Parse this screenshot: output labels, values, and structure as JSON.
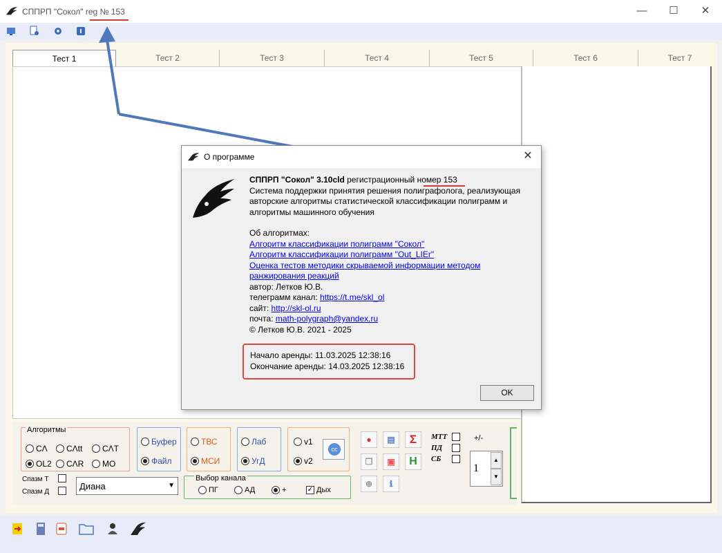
{
  "window": {
    "title_prefix": "СППРП \"Сокол\"",
    "title_reg": "reg № 153",
    "minimize": "—",
    "maximize": "☐",
    "close": "✕"
  },
  "toolbar": {
    "icons": [
      "monitor-icon",
      "document-search-icon",
      "gear-icon",
      "info-icon"
    ]
  },
  "tabs": [
    "Тест 1",
    "Тест 2",
    "Тест 3",
    "Тест 4",
    "Тест 5",
    "Тест 6",
    "Тест 7"
  ],
  "controls": {
    "algorithms": {
      "label": "Алгоритмы",
      "options": [
        "СΛ",
        "СΛtt",
        "СΛТ",
        "OL2",
        "СΛR",
        "МО"
      ],
      "selected": "OL2"
    },
    "source": {
      "options": [
        "Буфер",
        "Файл"
      ],
      "selected": "Файл"
    },
    "test_type": {
      "options": [
        "ТВС",
        "МСИ"
      ],
      "selected": "МСИ"
    },
    "lab": {
      "options": [
        "Лаб",
        "УгД"
      ],
      "selected": "УгД"
    },
    "version": {
      "options": [
        "v1",
        "v2"
      ],
      "selected": "v2"
    },
    "cc_button": "cc",
    "spasm_t": "Спазм Т",
    "spasm_d": "Спазм Д",
    "person": "Диана",
    "channel": {
      "label": "Выбор канала",
      "options": [
        "ПГ",
        "АД",
        "+"
      ],
      "selected": "+",
      "breath_label": "Дых",
      "breath_checked": true
    },
    "flags": [
      "МТТ",
      "ПД",
      "СБ"
    ],
    "plusminus_label": "+/-",
    "spinner_value": "1",
    "sigma": "Σ",
    "h": "H"
  },
  "dialog": {
    "title": "О программе",
    "close": "✕",
    "product_bold": "СППРП \"Сокол\" 3.10cld",
    "product_rest": " регистрационный ",
    "reg_number": "номер 153",
    "description": "Система поддержки принятия решения полиграфолога, реализующая авторские алгоритмы статистической классификации полиграмм и алгоритмы машинного обучения",
    "about_algorithms": "Об алгоритмах:",
    "links": [
      "Алгоритм классификации полиграмм \"Сокол\"",
      "Алгоритм классификации полиграмм \"Out_LIEr\"",
      "Оценка тестов методики скрываемой информации методом ранжирования реакций"
    ],
    "author": "автор: Летков Ю.В.",
    "telegram_label": "телеграмм канал: ",
    "telegram_link": "https://t.me/skl_ol",
    "site_label": "сайт: ",
    "site_link": "http://skl-ol.ru",
    "mail_label": "почта: ",
    "mail_link": "math-polygraph@yandex.ru",
    "copyright": "© Летков Ю.В. 2021 - 2025",
    "rent_start": "Начало аренды: 11.03.2025 12:38:16",
    "rent_end": "Окончание аренды: 14.03.2025 12:38:16",
    "ok": "OK"
  },
  "bottombar": {
    "icons": [
      "export-icon",
      "calculator-icon",
      "pdf-icon",
      "folder-icon",
      "person-icon",
      "falcon-icon"
    ]
  },
  "colors": {
    "annotation_red": "#d63a2e",
    "arrow_blue": "#4f79bc",
    "link": "#0000ee"
  }
}
